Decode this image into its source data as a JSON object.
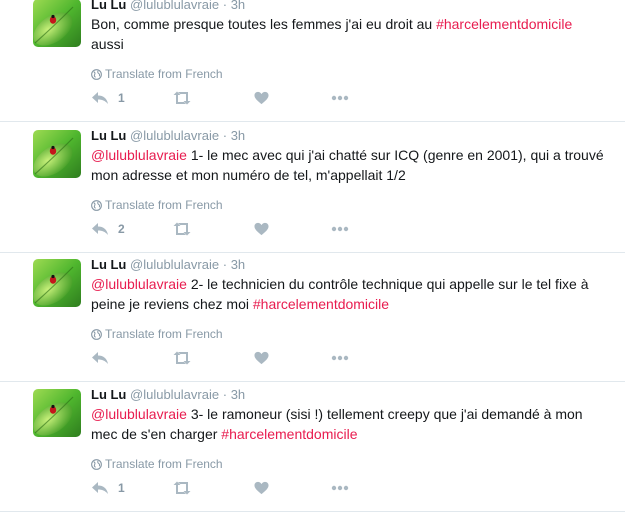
{
  "colors": {
    "link": "#e81c4f",
    "meta": "#8899a6",
    "text": "#14171a"
  },
  "tweets": [
    {
      "name": "Lu Lu",
      "handle": "@lulublulavraie",
      "dot": "·",
      "time": "3h",
      "parts": [
        {
          "text": "Bon, comme presque toutes les femmes j'ai eu droit au ",
          "link": false
        },
        {
          "text": "#harcelementdomicile",
          "link": true
        },
        {
          "text": " aussi",
          "link": false
        }
      ],
      "translate": "Translate from French",
      "reply_count": "1"
    },
    {
      "name": "Lu Lu",
      "handle": "@lulublulavraie",
      "dot": "·",
      "time": "3h",
      "parts": [
        {
          "text": "@lulublulavraie",
          "link": true
        },
        {
          "text": " 1- le mec avec qui j'ai chatté sur ICQ (genre en 2001), qui a trouvé mon adresse et mon numéro de tel, m'appellait 1/2",
          "link": false
        }
      ],
      "translate": "Translate from French",
      "reply_count": "2"
    },
    {
      "name": "Lu Lu",
      "handle": "@lulublulavraie",
      "dot": "·",
      "time": "3h",
      "parts": [
        {
          "text": "@lulublulavraie",
          "link": true
        },
        {
          "text": " 2- le technicien du contrôle technique qui appelle sur le tel fixe à peine je reviens chez moi ",
          "link": false
        },
        {
          "text": "#harcelementdomicile",
          "link": true
        }
      ],
      "translate": "Translate from French",
      "reply_count": ""
    },
    {
      "name": "Lu Lu",
      "handle": "@lulublulavraie",
      "dot": "·",
      "time": "3h",
      "parts": [
        {
          "text": "@lulublulavraie",
          "link": true
        },
        {
          "text": " 3- le ramoneur (sisi !) tellement creepy que j'ai demandé à mon mec de s'en charger ",
          "link": false
        },
        {
          "text": "#harcelementdomicile",
          "link": true
        }
      ],
      "translate": "Translate from French",
      "reply_count": "1"
    }
  ]
}
